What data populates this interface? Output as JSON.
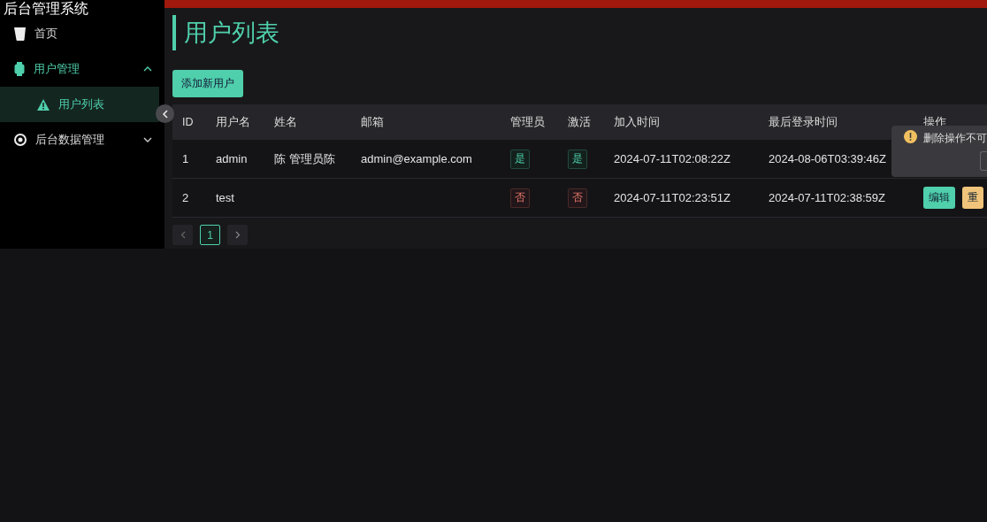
{
  "sidebar": {
    "title": "后台管理系统",
    "items": [
      {
        "label": "首页"
      },
      {
        "label": "用户管理",
        "expanded": true,
        "children": [
          {
            "label": "用户列表",
            "selected": true
          }
        ]
      },
      {
        "label": "后台数据管理",
        "expanded": false
      }
    ]
  },
  "page": {
    "title": "用户列表",
    "add_button": "添加新用户"
  },
  "table": {
    "columns": [
      "ID",
      "用户名",
      "姓名",
      "邮箱",
      "管理员",
      "激活",
      "加入时间",
      "最后登录时间",
      "操作"
    ],
    "rows": [
      {
        "id": "1",
        "username": "admin",
        "name": "陈 管理员陈",
        "email": "admin@example.com",
        "admin": {
          "text": "是",
          "positive": true
        },
        "active": {
          "text": "是",
          "positive": true
        },
        "joined": "2024-07-11T02:08:22Z",
        "last_login": "2024-08-06T03:39:46Z"
      },
      {
        "id": "2",
        "username": "test",
        "admin": {
          "text": "否",
          "positive": false
        },
        "active": {
          "text": "否",
          "positive": false
        },
        "joined": "2024-07-11T02:23:51Z",
        "last_login": "2024-07-11T02:38:59Z",
        "actions": [
          {
            "label": "编辑",
            "kind": "edit"
          },
          {
            "label": "重",
            "kind": "warn"
          }
        ]
      }
    ]
  },
  "pagination": {
    "pages": [
      {
        "label": "1",
        "selected": true
      }
    ]
  },
  "popconfirm": {
    "message": "删除操作不可"
  }
}
